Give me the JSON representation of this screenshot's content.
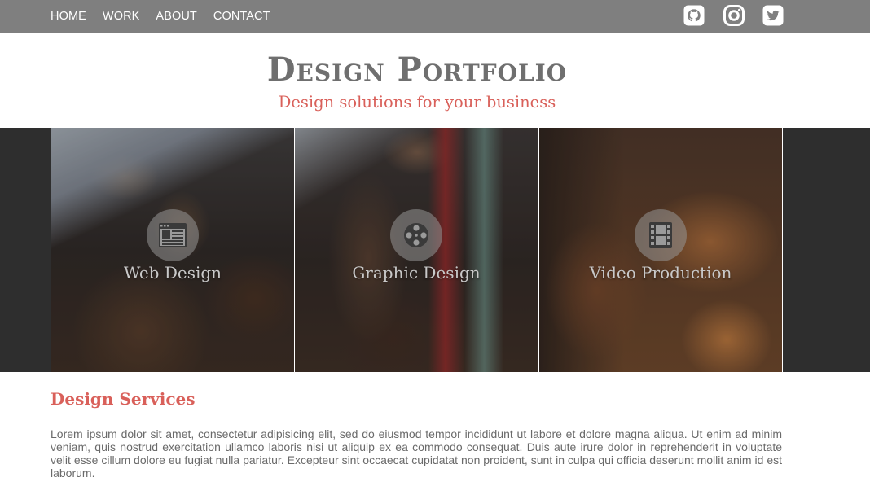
{
  "nav": {
    "items": [
      {
        "label": "HOME"
      },
      {
        "label": "WORK"
      },
      {
        "label": "ABOUT"
      },
      {
        "label": "CONTACT"
      }
    ],
    "social": [
      "github-icon",
      "instagram-icon",
      "twitter-icon"
    ]
  },
  "header": {
    "title": "Design Portfolio",
    "subtitle": "Design solutions for your business"
  },
  "services": [
    {
      "label": "Web Design",
      "icon": "browser-window-icon"
    },
    {
      "label": "Graphic Design",
      "icon": "film-reel-icon"
    },
    {
      "label": "Video Production",
      "icon": "film-strip-icon"
    }
  ],
  "content": {
    "heading": "Design Services",
    "body": "Lorem ipsum dolor sit amet, consectetur adipisicing elit, sed do eiusmod tempor incididunt ut labore et dolore magna aliqua. Ut enim ad minim veniam, quis nostrud exercitation ullamco laboris nisi ut aliquip ex ea commodo consequat. Duis aute irure dolor in reprehenderit in voluptate velit esse cillum dolore eu fugiat nulla pariatur. Excepteur sint occaecat cupidatat non proident, sunt in culpa qui officia deserunt mollit anim id est laborum."
  },
  "colors": {
    "nav_bg": "#7f7f7f",
    "accent": "#d9605a",
    "title_gray": "#6f6f6f",
    "strip_bg": "#2e2e2e"
  }
}
